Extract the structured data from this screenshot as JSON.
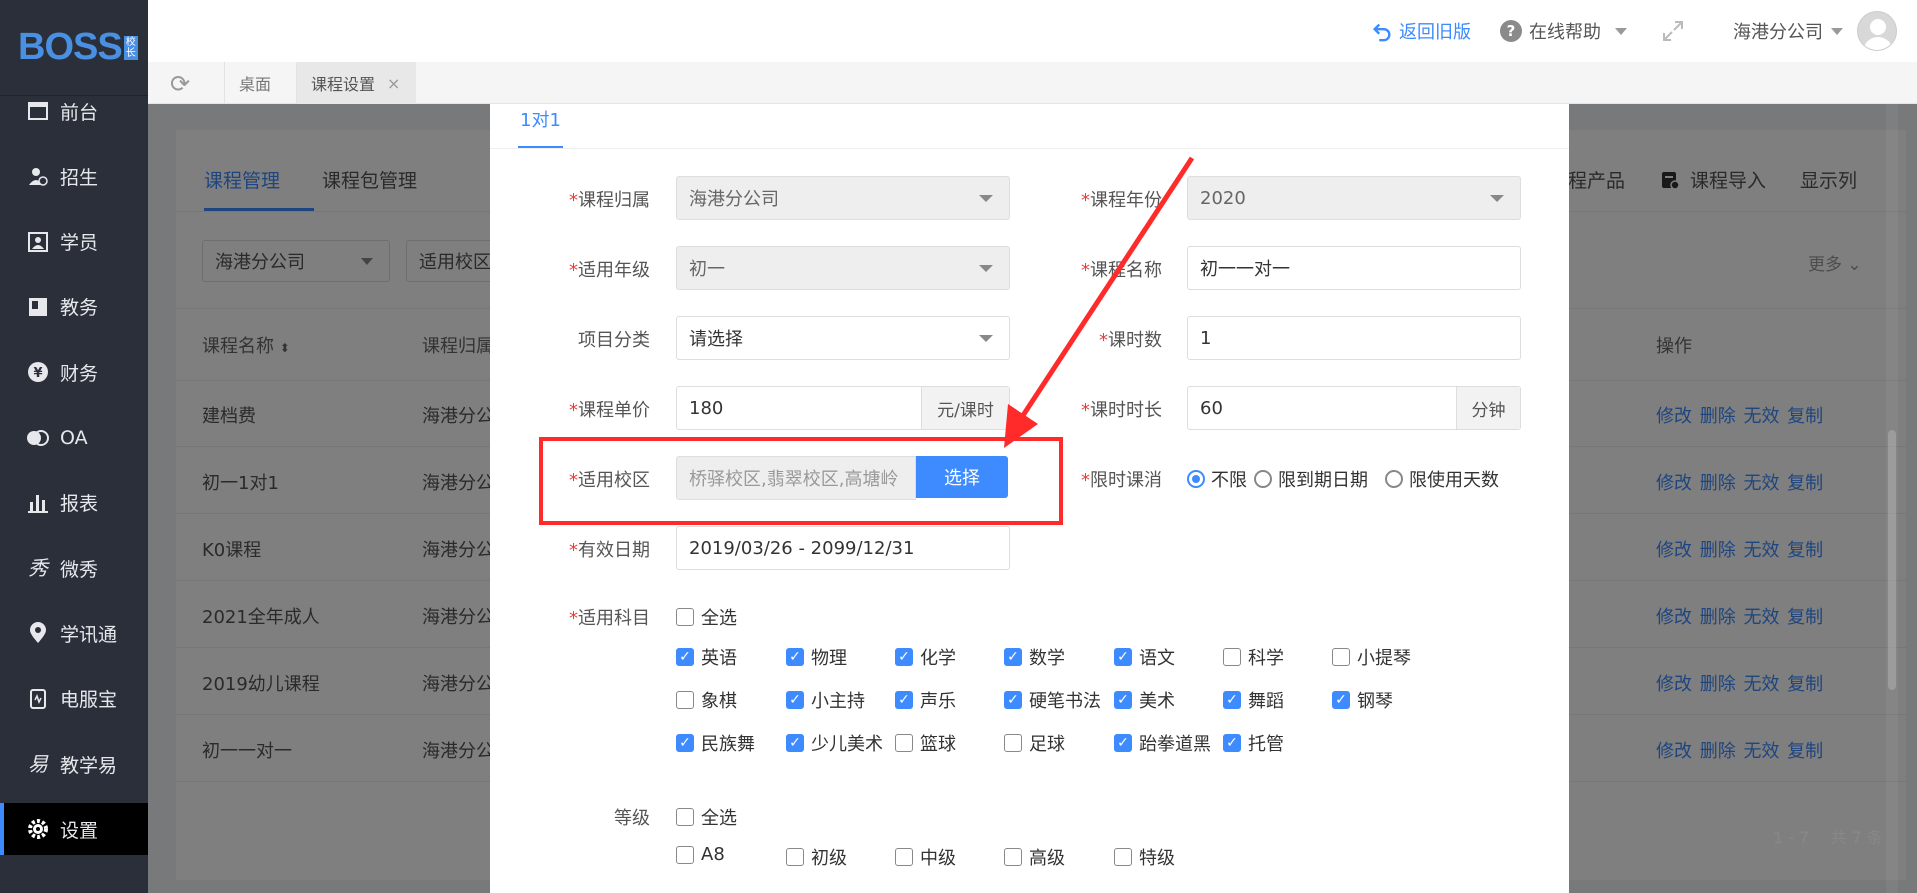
{
  "sidebar": {
    "logo": "BOSS",
    "logo_badge": [
      "校",
      "长"
    ],
    "items": [
      {
        "label": "前台",
        "icon": "calendar-icon"
      },
      {
        "label": "招生",
        "icon": "user-add-icon"
      },
      {
        "label": "学员",
        "icon": "student-card-icon"
      },
      {
        "label": "教务",
        "icon": "book-icon"
      },
      {
        "label": "财务",
        "icon": "yen-icon"
      },
      {
        "label": "OA",
        "icon": "chat-icon"
      },
      {
        "label": "报表",
        "icon": "bar-chart-icon"
      },
      {
        "label": "微秀",
        "icon": "weixiu-icon"
      },
      {
        "label": "学讯通",
        "icon": "location-icon"
      },
      {
        "label": "电服宝",
        "icon": "phone-icon"
      },
      {
        "label": "教学易",
        "icon": "teach-icon"
      },
      {
        "label": "设置",
        "icon": "gear-icon",
        "active": true
      }
    ]
  },
  "topbar": {
    "back_old": "返回旧版",
    "help": "在线帮助",
    "company": "海港分公司"
  },
  "tabs": [
    {
      "label": "桌面"
    },
    {
      "label": "课程设置",
      "active": true,
      "close": "×"
    }
  ],
  "panel": {
    "tabs": [
      "课程管理",
      "课程包管理"
    ],
    "filters": [
      "海港分公司",
      "适用校区"
    ],
    "right_actions": [
      "程产品",
      "课程导入",
      "显示列"
    ],
    "more": "更多",
    "columns": [
      "课程名称",
      "课程归属",
      "操作"
    ],
    "rows": [
      {
        "name": "建档费",
        "owner": "海港分公"
      },
      {
        "name": "初一1对1",
        "owner": "海港分公"
      },
      {
        "name": "K0课程",
        "owner": "海港分公"
      },
      {
        "name": "2021全年成人",
        "owner": "海港分公"
      },
      {
        "name": "2019幼儿课程",
        "owner": "海港分公"
      },
      {
        "name": "初一一对一",
        "owner": "海港分公"
      }
    ],
    "row_actions": "修改 删除 无效 复制",
    "pager": "1 - 7 　共 7 条"
  },
  "modal": {
    "tab": "1对1",
    "fields": {
      "course_owner": {
        "label": "课程归属",
        "value": "海港分公司"
      },
      "course_year": {
        "label": "课程年份",
        "value": "2020"
      },
      "grade": {
        "label": "适用年级",
        "value": "初一"
      },
      "course_name": {
        "label": "课程名称",
        "value": "初一一对一"
      },
      "category": {
        "label": "项目分类",
        "placeholder": "请选择"
      },
      "hours": {
        "label": "课时数",
        "value": "1"
      },
      "unit_price": {
        "label": "课程单价",
        "value": "180",
        "unit": "元/课时"
      },
      "duration": {
        "label": "课时时长",
        "value": "60",
        "unit": "分钟"
      },
      "campus": {
        "label": "适用校区",
        "value": "桥驿校区,翡翠校区,高塘岭",
        "button": "选择"
      },
      "time_limit": {
        "label": "限时课消",
        "options": [
          "不限",
          "限到期日期",
          "限使用天数"
        ],
        "selected": 0
      },
      "valid_date": {
        "label": "有效日期",
        "value": "2019/03/26 - 2099/12/31"
      }
    },
    "subjects": {
      "label": "适用科目",
      "select_all": "全选",
      "items": [
        {
          "label": "英语",
          "checked": true
        },
        {
          "label": "物理",
          "checked": true
        },
        {
          "label": "化学",
          "checked": true
        },
        {
          "label": "数学",
          "checked": true
        },
        {
          "label": "语文",
          "checked": true
        },
        {
          "label": "科学",
          "checked": false
        },
        {
          "label": "小提琴",
          "checked": false
        },
        {
          "label": "象棋",
          "checked": false
        },
        {
          "label": "小主持",
          "checked": true
        },
        {
          "label": "声乐",
          "checked": true
        },
        {
          "label": "硬笔书法",
          "checked": true
        },
        {
          "label": "美术",
          "checked": true
        },
        {
          "label": "舞蹈",
          "checked": true
        },
        {
          "label": "钢琴",
          "checked": true
        },
        {
          "label": "民族舞",
          "checked": true
        },
        {
          "label": "少儿美术",
          "checked": true
        },
        {
          "label": "篮球",
          "checked": false
        },
        {
          "label": "足球",
          "checked": false
        },
        {
          "label": "跆拳道黑",
          "checked": true
        },
        {
          "label": "托管",
          "checked": true
        }
      ]
    },
    "levels": {
      "label": "等级",
      "select_all": "全选",
      "items": [
        {
          "label": "A8",
          "checked": false
        },
        {
          "label": "初级",
          "checked": false
        },
        {
          "label": "中级",
          "checked": false
        },
        {
          "label": "高级",
          "checked": false
        },
        {
          "label": "特级",
          "checked": false
        }
      ]
    }
  },
  "colors": {
    "accent": "#3d8bff",
    "highlight": "#ff2b2b",
    "sidebar": "#2a2f3a"
  }
}
